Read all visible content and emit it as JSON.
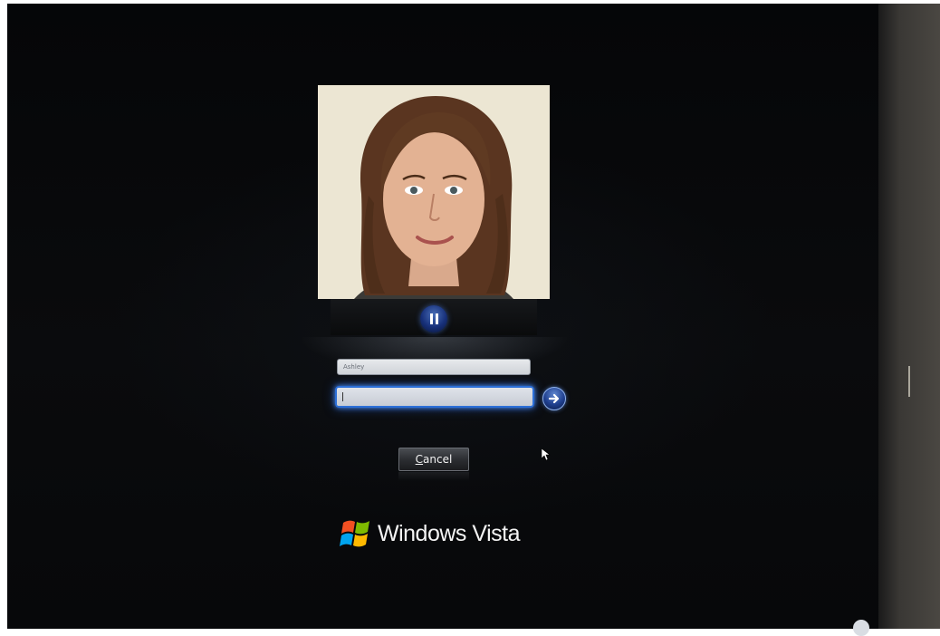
{
  "login": {
    "username": "Ashley",
    "password_value": "",
    "cancel_label": "Cancel",
    "cancel_mnemonic": "C",
    "cancel_rest": "ancel"
  },
  "branding": {
    "product": "Windows Vista"
  },
  "icons": {
    "pause": "pause-icon",
    "submit": "arrow-right-icon",
    "logo": "windows-flag-icon",
    "cursor": "mouse-pointer-icon"
  },
  "colors": {
    "focus_glow": "#2c6fd8",
    "button_blue": "#1f3f8e",
    "background": "#07080a"
  }
}
